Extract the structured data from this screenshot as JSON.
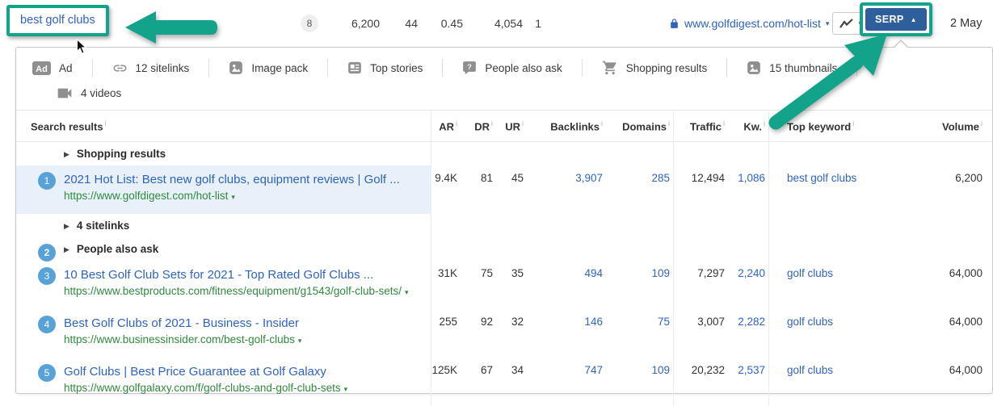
{
  "colors": {
    "accent_teal": "#12a38a",
    "serp_button_blue": "#2e5e9c",
    "link_blue": "#2e63c2",
    "url_green": "#2f8a3d",
    "badge_blue": "#57a2d9",
    "highlight_row": "#e8f1fa"
  },
  "topbar": {
    "keyword": "best golf clubs",
    "position_badge": "8",
    "metrics": [
      "6,200",
      "44",
      "0.45",
      "4,054",
      "1"
    ],
    "url": "www.golfdigest.com/hot-list",
    "url_caret": "▾",
    "serp_label": "SERP",
    "serp_caret": "▲",
    "chart_caret": "▼",
    "date": "2 May"
  },
  "features": {
    "row1": [
      {
        "icon": "ad-icon",
        "label": "Ad"
      },
      {
        "icon": "sitelinks-icon",
        "label": "12 sitelinks"
      },
      {
        "icon": "image-pack-icon",
        "label": "Image pack"
      },
      {
        "icon": "top-stories-icon",
        "label": "Top stories"
      },
      {
        "icon": "people-also-ask-icon",
        "label": "People also ask"
      },
      {
        "icon": "shopping-cart-icon",
        "label": "Shopping results"
      },
      {
        "icon": "thumbnails-icon",
        "label": "15 thumbnails"
      }
    ],
    "row2": [
      {
        "icon": "videos-icon",
        "label": "4 videos"
      }
    ]
  },
  "table": {
    "headers": [
      {
        "key": "search-results",
        "label": "Search results"
      },
      {
        "key": "ar",
        "label": "AR"
      },
      {
        "key": "dr",
        "label": "DR"
      },
      {
        "key": "ur",
        "label": "UR"
      },
      {
        "key": "backlinks",
        "label": "Backlinks"
      },
      {
        "key": "domains",
        "label": "Domains"
      },
      {
        "key": "traffic",
        "label": "Traffic"
      },
      {
        "key": "kw",
        "label": "Kw."
      },
      {
        "key": "top-keyword",
        "label": "Top keyword"
      },
      {
        "key": "volume",
        "label": "Volume"
      }
    ],
    "rows": [
      {
        "type": "group",
        "badge": "",
        "label": "Shopping results"
      },
      {
        "type": "result",
        "badge": "1",
        "highlighted": true,
        "title": "2021 Hot List: Best new golf clubs, equipment reviews | Golf ...",
        "url": "https://www.golfdigest.com/hot-list",
        "ar": "9.4K",
        "dr": "81",
        "ur": "45",
        "backlinks": "3,907",
        "domains": "285",
        "traffic": "12,494",
        "kw": "1,086",
        "top_keyword": "best golf clubs",
        "volume": "6,200"
      },
      {
        "type": "group",
        "badge": "",
        "label": "4 sitelinks"
      },
      {
        "type": "group",
        "badge": "2",
        "label": "People also ask"
      },
      {
        "type": "result",
        "badge": "3",
        "highlighted": false,
        "title": "10 Best Golf Club Sets for 2021 - Top Rated Golf Clubs ...",
        "url": "https://www.bestproducts.com/fitness/equipment/g1543/golf-club-sets/",
        "ar": "31K",
        "dr": "75",
        "ur": "35",
        "backlinks": "494",
        "domains": "109",
        "traffic": "7,297",
        "kw": "2,240",
        "top_keyword": "golf clubs",
        "volume": "64,000"
      },
      {
        "type": "result",
        "badge": "4",
        "highlighted": false,
        "title": "Best Golf Clubs of 2021 - Business - Insider",
        "url": "https://www.businessinsider.com/best-golf-clubs",
        "ar": "255",
        "dr": "92",
        "ur": "32",
        "backlinks": "146",
        "domains": "75",
        "traffic": "3,007",
        "kw": "2,282",
        "top_keyword": "golf clubs",
        "volume": "64,000"
      },
      {
        "type": "result",
        "badge": "5",
        "highlighted": false,
        "title": "Golf Clubs | Best Price Guarantee at Golf Galaxy",
        "url": "https://www.golfgalaxy.com/f/golf-clubs-and-golf-club-sets",
        "ar": "125K",
        "dr": "67",
        "ur": "34",
        "backlinks": "747",
        "domains": "109",
        "traffic": "20,232",
        "kw": "2,537",
        "top_keyword": "golf clubs",
        "volume": "64,000"
      }
    ]
  }
}
